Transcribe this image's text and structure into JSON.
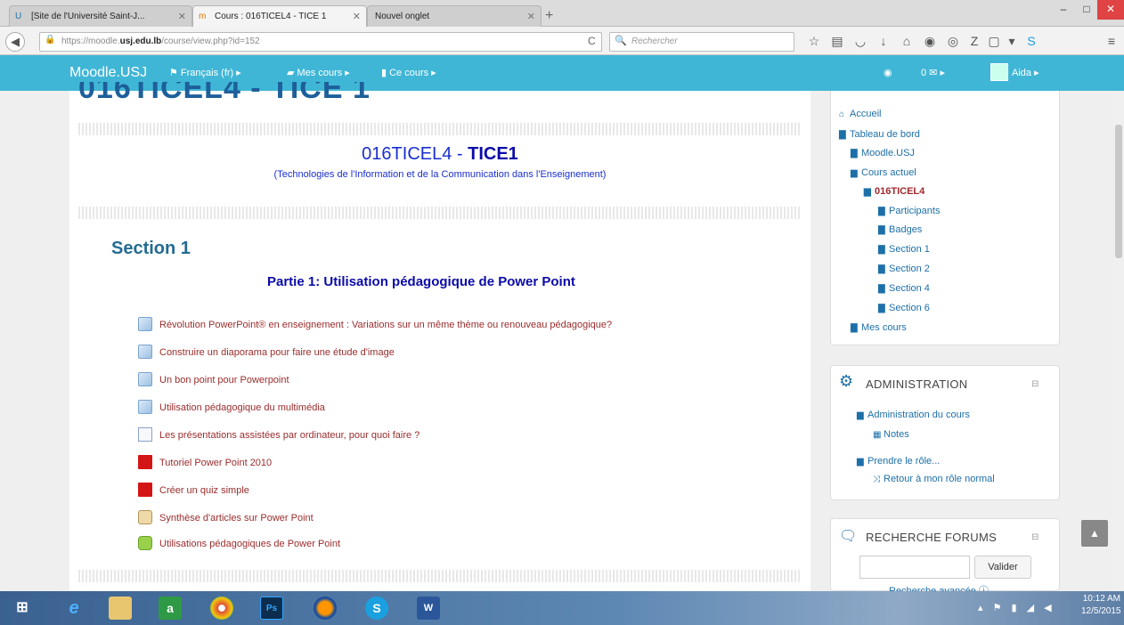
{
  "browser": {
    "tabs": [
      {
        "label": "[Site de l'Université Saint-J...",
        "active": false
      },
      {
        "label": "Cours : 016TICEL4 - TICE 1",
        "active": true
      },
      {
        "label": "Nouvel onglet",
        "active": false
      }
    ],
    "url_prefix": "https://moodle.",
    "url_domain": "usj.edu.lb",
    "url_path": "/course/view.php?id=152",
    "search_placeholder": "Rechercher",
    "window_buttons": [
      "–",
      "□",
      "✕"
    ]
  },
  "moodle_nav": {
    "brand": "Moodle.USJ",
    "language": "Français (fr) ▸",
    "my_courses": "Mes cours ▸",
    "this_course": "Ce cours ▸",
    "messages": "0 ✉ ▸",
    "user": "Aida ▸"
  },
  "course": {
    "cutoff_title": "016TICEL4 - TICE 1",
    "code": "016TICEL4 - ",
    "name": "TICE1",
    "subtitle": "(Technologies de l'Information et de la Communication dans l'Enseignement)",
    "section_title": "Section 1",
    "part_title": "Partie 1: Utilisation pédagogique de Power Point",
    "activities": [
      {
        "label": "Révolution PowerPoint® en enseignement : Variations sur un même thème ou renouveau pédagogique?",
        "icon": "url-icon"
      },
      {
        "label": "Construire un diaporama pour faire une étude d'image",
        "icon": "url-icon"
      },
      {
        "label": "Un bon point pour Powerpoint",
        "icon": "url-icon"
      },
      {
        "label": "Utilisation pédagogique du multimédia",
        "icon": "url-icon"
      },
      {
        "label": "Les présentations assistées par ordinateur, pour quoi faire ?",
        "icon": "page-icon"
      },
      {
        "label": "Tutoriel Power Point 2010",
        "icon": "pdf-icon"
      },
      {
        "label": "Créer un quiz simple",
        "icon": "pdf-icon"
      },
      {
        "label": "Synthèse d'articles sur Power Point",
        "icon": "book-icon"
      },
      {
        "label": "Utilisations pédagogiques de Power Point",
        "icon": "forum-icon"
      }
    ]
  },
  "navigation_block": {
    "items": [
      {
        "label": "Accueil",
        "icon": "home-icon"
      },
      {
        "label": "Tableau de bord",
        "icon": "folder-icon"
      },
      {
        "label": "Moodle.USJ",
        "icon": "folder-icon"
      },
      {
        "label": "Cours actuel",
        "icon": "folder-open-icon"
      },
      {
        "label": "016TICEL4",
        "icon": "folder-open-icon"
      },
      {
        "label": "Participants",
        "icon": "folder-icon"
      },
      {
        "label": "Badges",
        "icon": "folder-icon"
      },
      {
        "label": "Section 1",
        "icon": "folder-icon"
      },
      {
        "label": "Section 2",
        "icon": "folder-icon"
      },
      {
        "label": "Section 4",
        "icon": "folder-icon"
      },
      {
        "label": "Section 6",
        "icon": "folder-icon"
      },
      {
        "label": "Mes cours",
        "icon": "folder-icon"
      }
    ]
  },
  "admin_block": {
    "title": "ADMINISTRATION",
    "items": [
      {
        "label": "Administration du cours"
      },
      {
        "label": "Notes"
      },
      {
        "label": "Prendre le rôle..."
      },
      {
        "label": "Retour à mon rôle normal"
      }
    ]
  },
  "search_block": {
    "title": "RECHERCHE FORUMS",
    "button": "Valider",
    "advanced": "Recherche avancée ⓘ"
  },
  "taskbar": {
    "time": "10:12 AM",
    "date": "12/5/2015"
  },
  "colors": {
    "moodle_nav": "#40b6d6",
    "link": "#1d6fa8",
    "activity_link": "#9a2c2c",
    "course_title": "#0b0ba8"
  }
}
